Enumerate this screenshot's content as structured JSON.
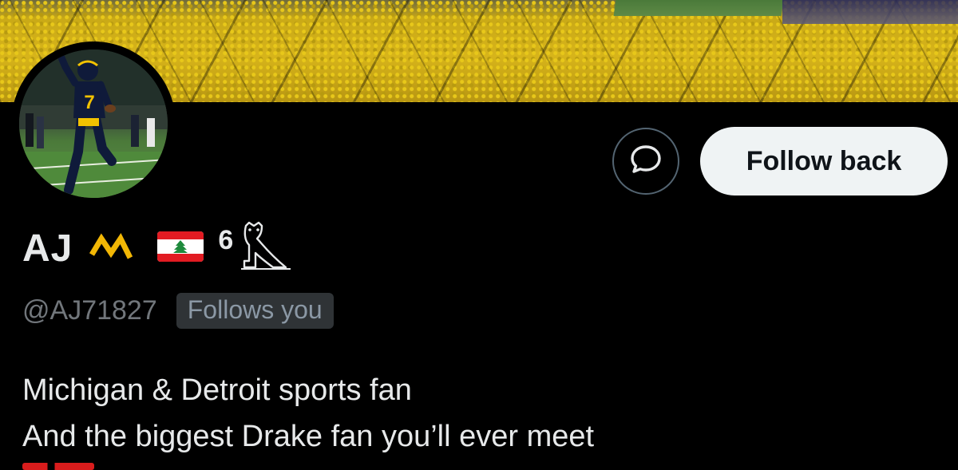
{
  "profile": {
    "name": "AJ",
    "name_emojis": [
      "maize-m-logo-icon",
      "lebanon-flag-icon",
      "six-god-text",
      "ovo-owl-icon"
    ],
    "six_text": "6",
    "handle": "@AJ71827",
    "follows_you_label": "Follows you",
    "bio_lines": [
      "Michigan & Detroit sports fan",
      "And the biggest Drake fan you’ll ever meet"
    ],
    "avatar_jersey_number": "7"
  },
  "actions": {
    "message_icon": "message-bubble-icon",
    "follow_back_label": "Follow back"
  },
  "colors": {
    "background": "#000000",
    "follow_button_bg": "#eff3f4",
    "follow_button_text": "#0f1419",
    "handle_color": "#71767b",
    "badge_bg": "#2f3336",
    "maize": "#f2b705",
    "lebanon_red": "#e21b22"
  }
}
